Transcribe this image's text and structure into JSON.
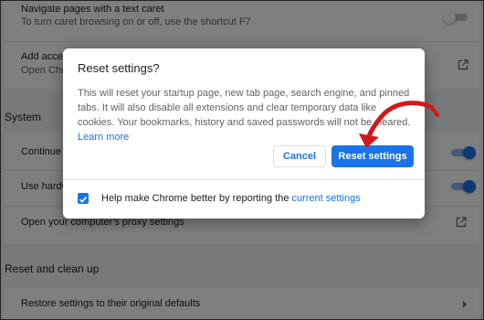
{
  "settings": {
    "accessibility": {
      "caret_title": "Navigate pages with a text caret",
      "caret_sub": "To turn caret browsing on or off, use the shortcut F7",
      "add_title": "Add access",
      "add_sub": "Open Chrom"
    },
    "system": {
      "heading": "System",
      "continue_label": "Continue ru",
      "hardware_label": "Use hardwa",
      "proxy_label": "Open your computer's proxy settings"
    },
    "reset": {
      "heading": "Reset and clean up",
      "restore_label": "Restore settings to their original defaults"
    }
  },
  "dialog": {
    "title": "Reset settings?",
    "body": "This will reset your startup page, new tab page, search engine, and pinned tabs. It will also disable all extensions and clear temporary data like cookies. Your bookmarks, history and saved passwords will not be cleared.",
    "learn_more": "Learn more",
    "cancel": "Cancel",
    "confirm": "Reset settings",
    "footer_text": "Help make Chrome better by reporting the",
    "footer_link": "current settings",
    "report_checked": true
  },
  "colors": {
    "accent": "#1a73e8",
    "arrow": "#d0191b"
  },
  "icons": [
    "external-link-icon",
    "chevron-right-icon",
    "checkmark-icon",
    "curved-arrow-icon"
  ]
}
